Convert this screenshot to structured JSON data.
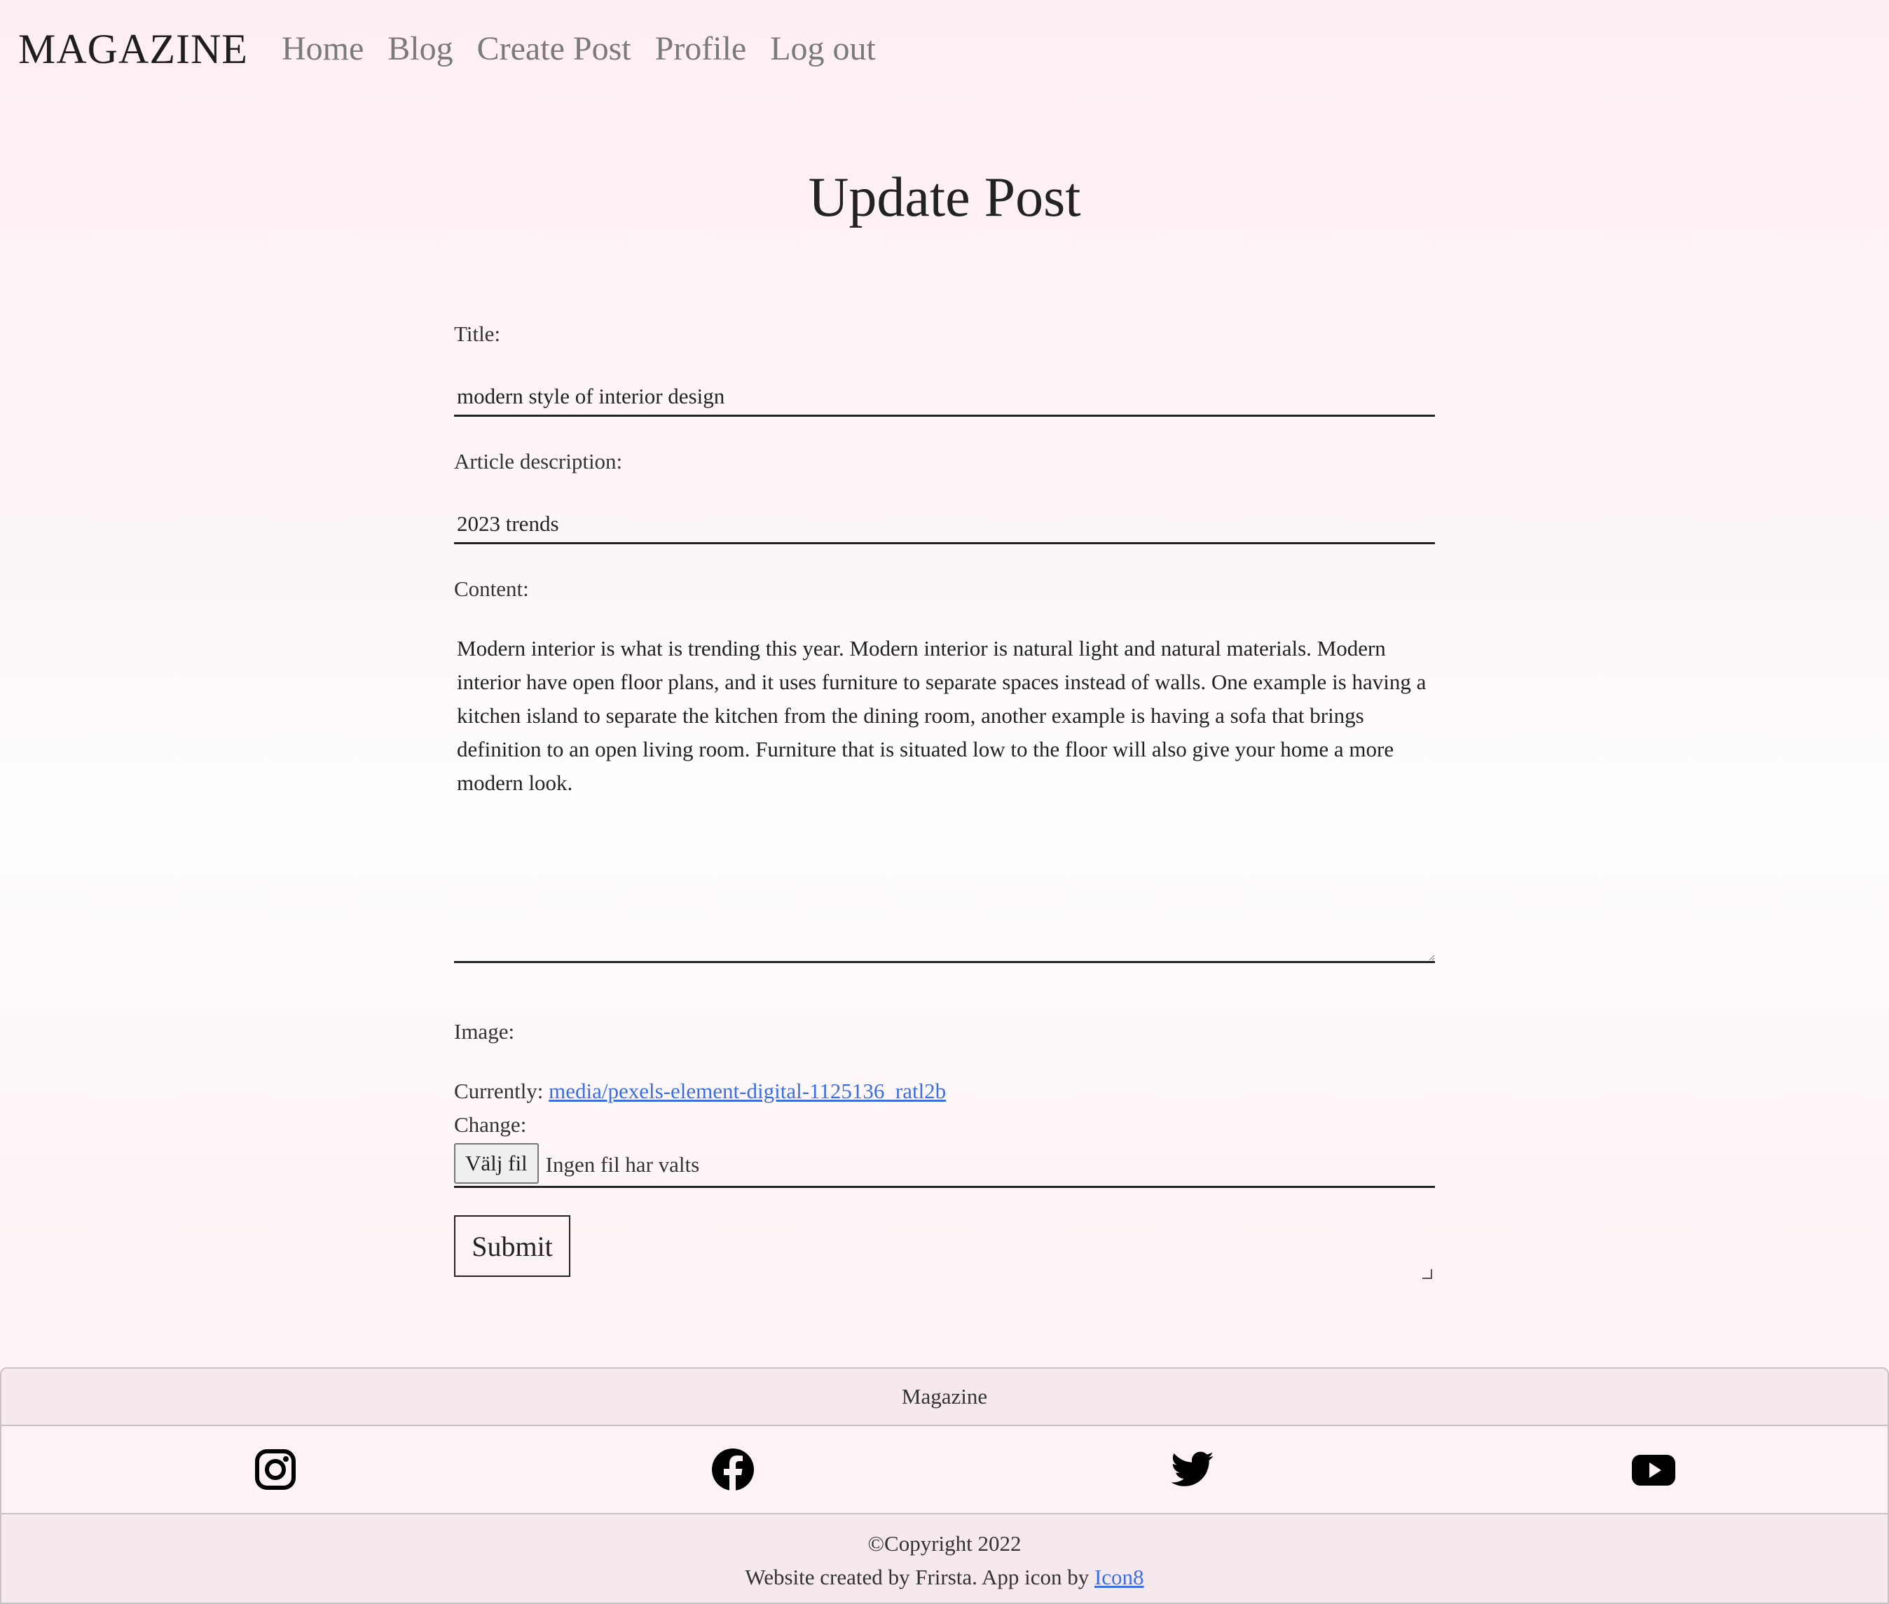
{
  "nav": {
    "brand": "MAGAZINE",
    "links": [
      "Home",
      "Blog",
      "Create Post",
      "Profile",
      "Log out"
    ]
  },
  "page": {
    "title": "Update Post"
  },
  "form": {
    "title_label": "Title:",
    "title_value": "modern style of interior design",
    "description_label": "Article description:",
    "description_value": "2023 trends",
    "content_label": "Content:",
    "content_value": "Modern interior is what is trending this year. Modern interior is natural light and natural materials. Modern interior have open floor plans, and it uses furniture to separate spaces instead of walls. One example is having a kitchen island to separate the kitchen from the dining room, another example is having a sofa that brings definition to an open living room. Furniture that is situated low to the floor will also give your home a more modern look.",
    "image_label": "Image:",
    "currently_label": "Currently:",
    "currently_file": "media/pexels-element-digital-1125136_ratl2b",
    "change_label": "Change:",
    "file_button": "Välj fil",
    "file_status": "Ingen fil har valts",
    "submit_label": "Submit"
  },
  "footer": {
    "title": "Magazine",
    "social_icons": [
      "instagram-icon",
      "facebook-icon",
      "twitter-icon",
      "youtube-icon"
    ],
    "copyright": "©Copyright 2022",
    "credit_text": "Website created by Frirsta. App icon by",
    "credit_link": "Icon8"
  },
  "colors": {
    "link": "#3b6fe0",
    "text": "#222222",
    "nav_link": "#7a7a7a",
    "footer_bg": "#f6e9ee"
  }
}
